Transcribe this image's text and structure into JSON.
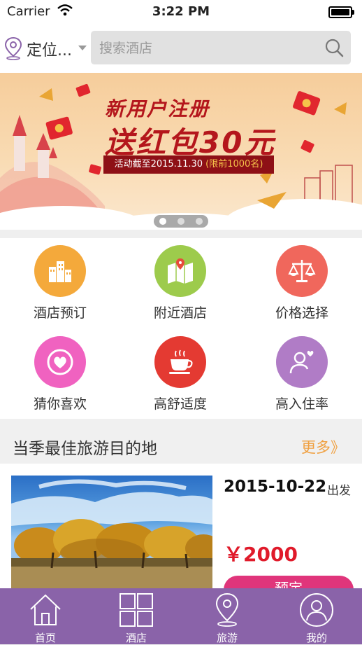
{
  "status_bar": {
    "carrier": "Carrier",
    "time": "3:22 PM"
  },
  "topbar": {
    "location_label": "定位...",
    "search_placeholder": "搜索酒店"
  },
  "banner": {
    "line1": "新用户注册",
    "line2": "送红包30元",
    "ribbon_text": "活动截至2015.11.30",
    "ribbon_highlight": "(限前1000名)",
    "page_count": 3,
    "active_page": 1
  },
  "grid": [
    {
      "label": "酒店预订",
      "icon": "hotel-buildings-icon",
      "color": "#f4a93b"
    },
    {
      "label": "附近酒店",
      "icon": "map-pin-icon",
      "color": "#9dcb4c"
    },
    {
      "label": "价格选择",
      "icon": "scale-icon",
      "color": "#f0675c"
    },
    {
      "label": "猜你喜欢",
      "icon": "heart-icon",
      "color": "#f062c0"
    },
    {
      "label": "高舒适度",
      "icon": "coffee-cup-icon",
      "color": "#e43a32"
    },
    {
      "label": "高入住率",
      "icon": "person-heart-icon",
      "color": "#b07cc6"
    }
  ],
  "section": {
    "title": "当季最佳旅游目的地",
    "more": "更多》"
  },
  "card": {
    "date": "2015-10-22",
    "depart": "出发",
    "price": "￥2000",
    "book_label": "预定"
  },
  "tabbar": [
    {
      "label": "首页",
      "icon": "home-icon"
    },
    {
      "label": "酒店",
      "icon": "grid-icon"
    },
    {
      "label": "旅游",
      "icon": "location-pin-icon"
    },
    {
      "label": "我的",
      "icon": "user-icon"
    }
  ],
  "colors": {
    "tabbar": "#8a63a9",
    "accent_more": "#f0a040",
    "price": "#e01a2a",
    "book_button": "#e0357b"
  }
}
